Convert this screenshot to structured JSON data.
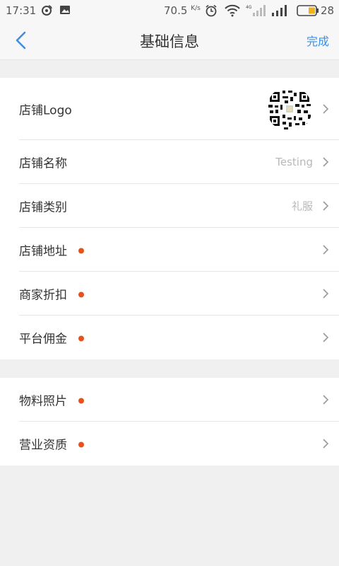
{
  "status_bar": {
    "time": "17:31",
    "speed": "70.5",
    "speed_unit": "K/s",
    "battery_percent": "28"
  },
  "nav": {
    "title": "基础信息",
    "done_label": "完成"
  },
  "section1": {
    "rows": [
      {
        "label": "店铺Logo",
        "value": ""
      },
      {
        "label": "店铺名称",
        "value": "Testing"
      },
      {
        "label": "店铺类别",
        "value": "礼服"
      },
      {
        "label": "店铺地址",
        "value": ""
      },
      {
        "label": "商家折扣",
        "value": ""
      },
      {
        "label": "平台佣金",
        "value": ""
      }
    ]
  },
  "section2": {
    "rows": [
      {
        "label": "物料照片",
        "value": ""
      },
      {
        "label": "营业资质",
        "value": ""
      }
    ]
  },
  "colors": {
    "accent": "#3d8ee4",
    "required_dot": "#e8521a",
    "background": "#f0f0f0"
  }
}
